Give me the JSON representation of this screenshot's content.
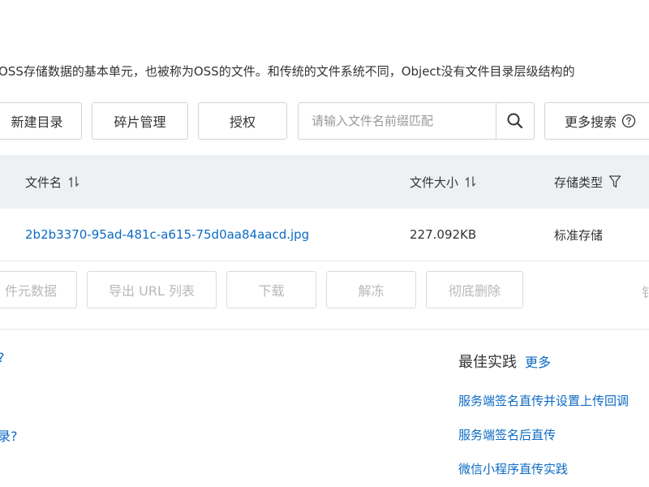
{
  "description": "OSS存储数据的基本单元，也被称为OSS的文件。和传统的文件系统不同，Object没有文件目录层级结构的",
  "toolbar": {
    "new_dir_label": "新建目录",
    "fragment_label": "碎片管理",
    "auth_label": "授权",
    "search_placeholder": "请输入文件名前缀匹配",
    "more_search_label": "更多搜索"
  },
  "table": {
    "headers": {
      "file_name": "文件名",
      "file_size": "文件大小",
      "storage_type": "存储类型"
    },
    "rows": [
      {
        "file_name": "2b2b3370-95ad-481c-a615-75d0aa84aacd.jpg",
        "file_size": "227.092KB",
        "storage_type": "标准存储"
      }
    ]
  },
  "actions": {
    "file_meta": "件元数据",
    "export_url": "导出 URL 列表",
    "download": "下载",
    "unfreeze": "解冻",
    "delete": "彻底删除",
    "cut_right": "钅"
  },
  "left_fragments": {
    "frag1": "?",
    "frag2": "录?"
  },
  "best_practice": {
    "title": "最佳实践",
    "more": "更多",
    "links": [
      "服务端签名直传并设置上传回调",
      "服务端签名后直传",
      "微信小程序直传实践"
    ]
  }
}
